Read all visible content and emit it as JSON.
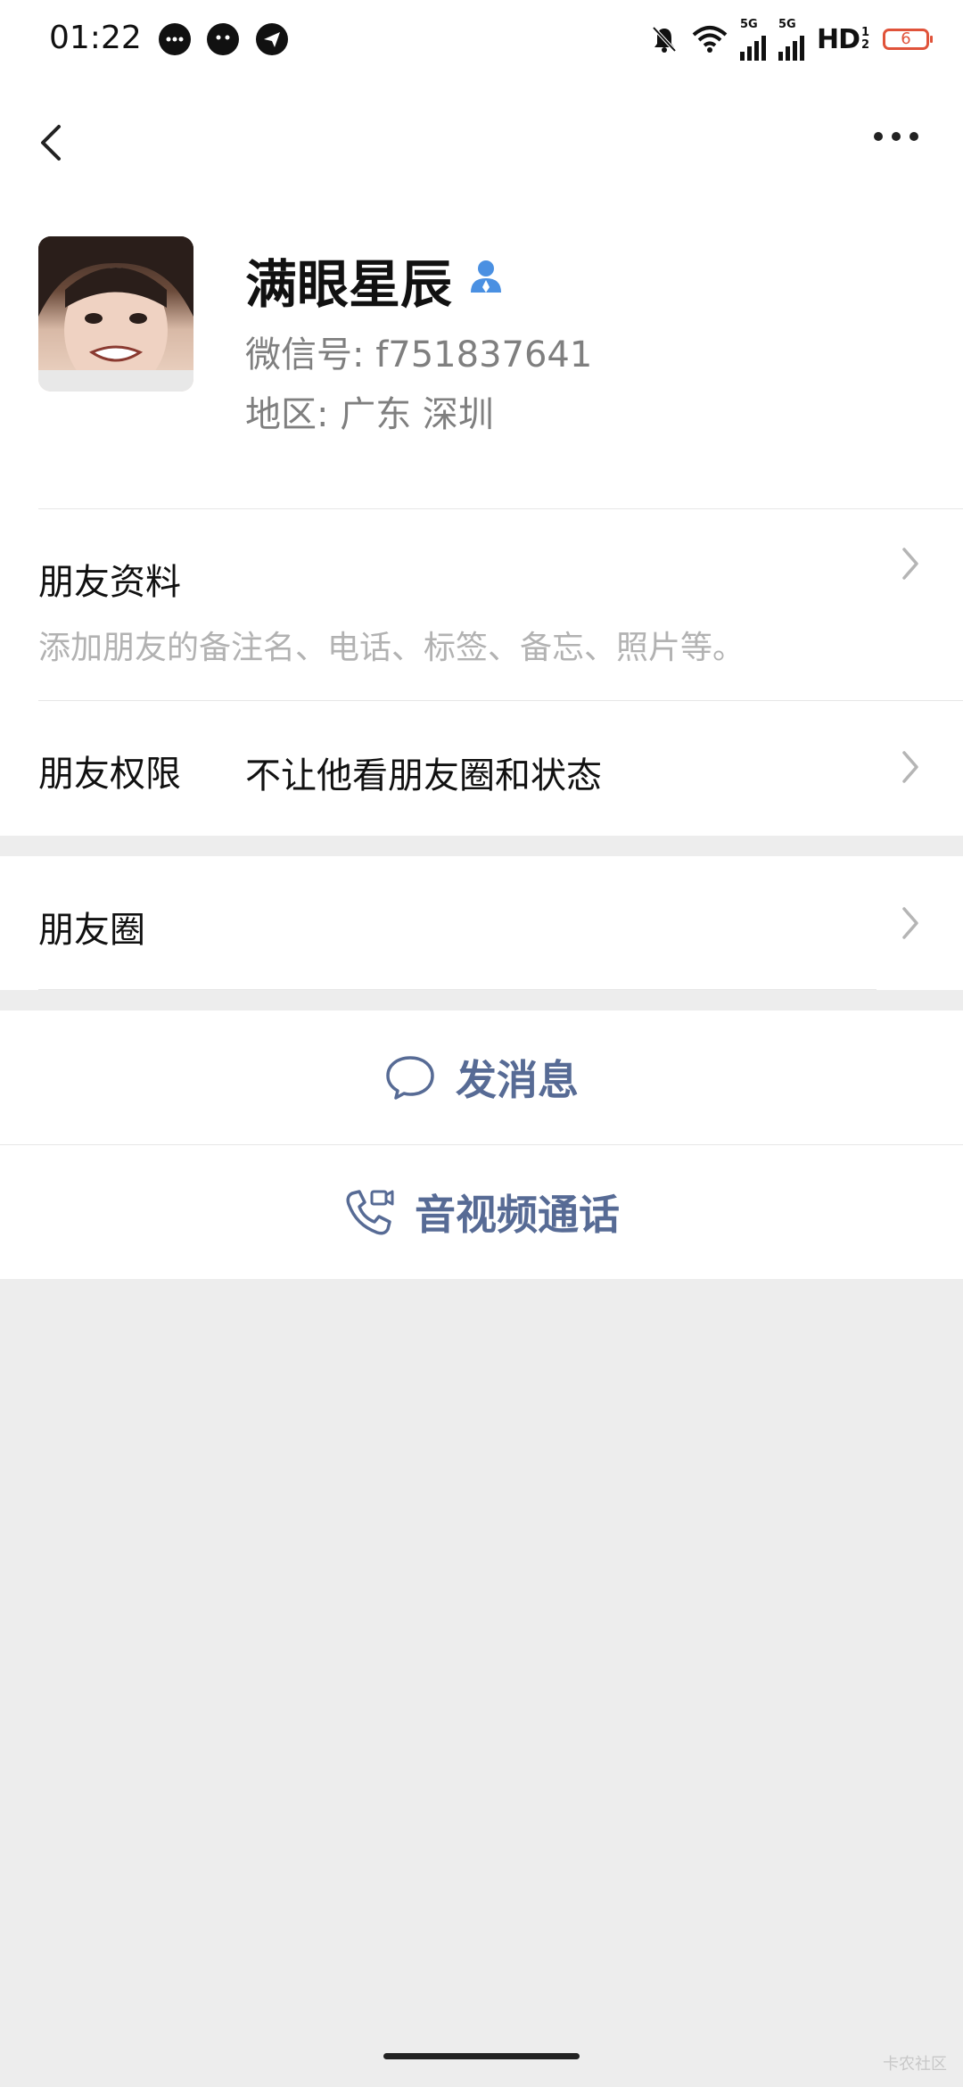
{
  "status_bar": {
    "time": "01:22",
    "hd_label": "HD",
    "hd_sub": "1 2",
    "net_1": "5G",
    "net_2": "5G",
    "battery": "6"
  },
  "profile": {
    "name": "满眼星辰",
    "wechat_id": "微信号: f751837641",
    "region": "地区: 广东  深圳"
  },
  "rows": {
    "friend_info_title": "朋友资料",
    "friend_info_sub": "添加朋友的备注名、电话、标签、备忘、照片等。",
    "permission_title": "朋友权限",
    "permission_value": "不让他看朋友圈和状态",
    "moments_title": "朋友圈"
  },
  "actions": {
    "send_message": "发消息",
    "av_call": "音视频通话"
  },
  "watermark": "卡农社区",
  "colors": {
    "link_blue": "#576b95",
    "badge_blue": "#4a90e2",
    "page_bg": "#ededed"
  }
}
